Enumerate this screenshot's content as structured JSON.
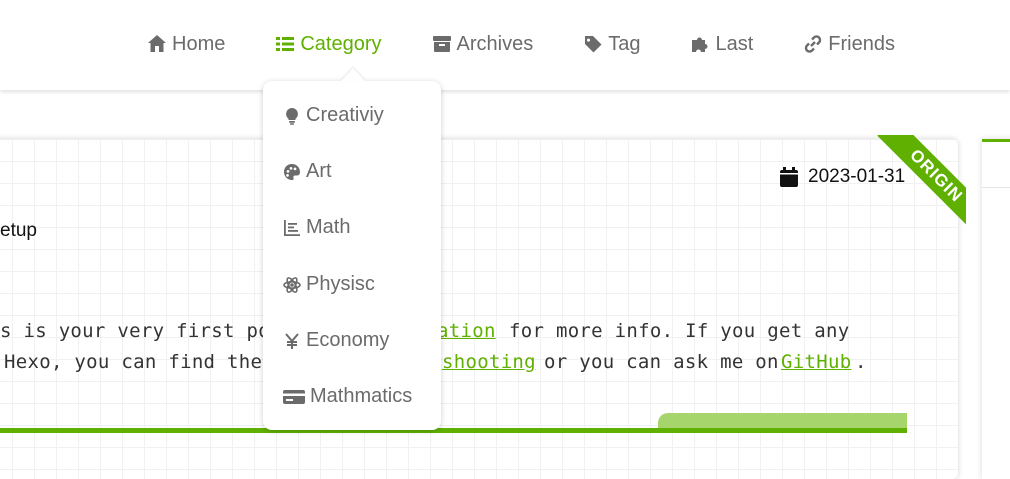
{
  "nav": {
    "items": [
      {
        "label": "Home",
        "icon": "home-icon"
      },
      {
        "label": "Category",
        "icon": "list-icon",
        "active": true
      },
      {
        "label": "Archives",
        "icon": "archive-icon"
      },
      {
        "label": "Tag",
        "icon": "tag-icon"
      },
      {
        "label": "Last",
        "icon": "puzzle-icon"
      },
      {
        "label": "Friends",
        "icon": "link-icon"
      }
    ]
  },
  "dropdown": {
    "items": [
      {
        "label": "Creativiy",
        "icon": "lightbulb-icon"
      },
      {
        "label": "Art",
        "icon": "palette-icon"
      },
      {
        "label": "Math",
        "icon": "chart-icon"
      },
      {
        "label": "Physisc",
        "icon": "atom-icon"
      },
      {
        "label": "Economy",
        "icon": "yen-icon"
      },
      {
        "label": "Mathmatics",
        "icon": "credit-card-icon"
      }
    ]
  },
  "post": {
    "ribbon": "ORIGIN",
    "date": "2023-01-31",
    "setup_text": "etup",
    "line1_a": "s is your very first post.",
    "line1_link": "ation",
    "line1_b": "for more info. If you get any",
    "line2_a": "Hexo, you can find the a",
    "line2_link": "shooting",
    "line2_b": "or you can ask me on",
    "line2_link2": "GitHub",
    "line2_end": "."
  },
  "colors": {
    "accent": "#5fb000",
    "text_muted": "#6b6b6b"
  }
}
